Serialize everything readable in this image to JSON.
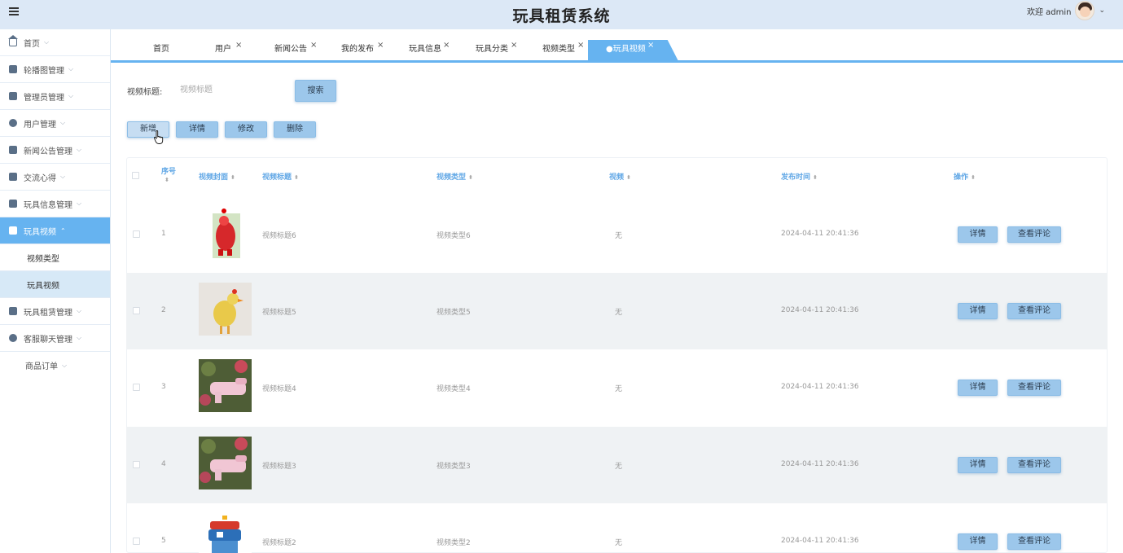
{
  "header": {
    "title": "玩具租赁系统",
    "welcome": "欢迎 admin"
  },
  "sidebar": {
    "items": [
      {
        "label": "首页",
        "icon": "home-icon"
      },
      {
        "label": "轮播图管理",
        "icon": "carousel-icon"
      },
      {
        "label": "管理员管理",
        "icon": "admin-icon"
      },
      {
        "label": "用户管理",
        "icon": "user-icon"
      },
      {
        "label": "新闻公告管理",
        "icon": "news-icon"
      },
      {
        "label": "交流心得",
        "icon": "briefcase-icon"
      },
      {
        "label": "玩具信息管理",
        "icon": "grid-icon"
      },
      {
        "label": "玩具视频",
        "icon": "grid-icon"
      },
      {
        "label": "玩具租赁管理",
        "icon": "rent-icon"
      },
      {
        "label": "客服聊天管理",
        "icon": "chat-icon"
      },
      {
        "label": "商品订单",
        "icon": ""
      }
    ],
    "subitems": [
      {
        "label": "视频类型"
      },
      {
        "label": "玩具视频"
      }
    ]
  },
  "tabs": [
    {
      "label": "首页"
    },
    {
      "label": "用户"
    },
    {
      "label": "新闻公告"
    },
    {
      "label": "我的发布"
    },
    {
      "label": "玩具信息"
    },
    {
      "label": "玩具分类"
    },
    {
      "label": "视频类型"
    },
    {
      "label": "●玩具视频"
    }
  ],
  "search": {
    "label": "视频标题:",
    "placeholder": "视频标题",
    "button": "搜索"
  },
  "actions": {
    "add": "新增",
    "detail": "详情",
    "edit": "修改",
    "delete": "删除"
  },
  "table": {
    "columns": {
      "index": "序号",
      "cover": "视频封面",
      "title": "视频标题",
      "type": "视频类型",
      "video": "视频",
      "time": "发布时间",
      "ops": "操作"
    },
    "rows": [
      {
        "index": "1",
        "title": "视频标题6",
        "type": "视频类型6",
        "video": "无",
        "time": "2024-04-11 20:41:36"
      },
      {
        "index": "2",
        "title": "视频标题5",
        "type": "视频类型5",
        "video": "无",
        "time": "2024-04-11 20:41:36"
      },
      {
        "index": "3",
        "title": "视频标题4",
        "type": "视频类型4",
        "video": "无",
        "time": "2024-04-11 20:41:36"
      },
      {
        "index": "4",
        "title": "视频标题3",
        "type": "视频类型3",
        "video": "无",
        "time": "2024-04-11 20:41:36"
      },
      {
        "index": "5",
        "title": "视频标题2",
        "type": "视频类型2",
        "video": "无",
        "time": "2024-04-11 20:41:36"
      }
    ],
    "row_actions": {
      "detail": "详情",
      "comments": "查看评论"
    }
  },
  "colors": {
    "accent": "#66b3f0",
    "header_bg": "#dce8f6",
    "button": "#9cc7eb"
  }
}
